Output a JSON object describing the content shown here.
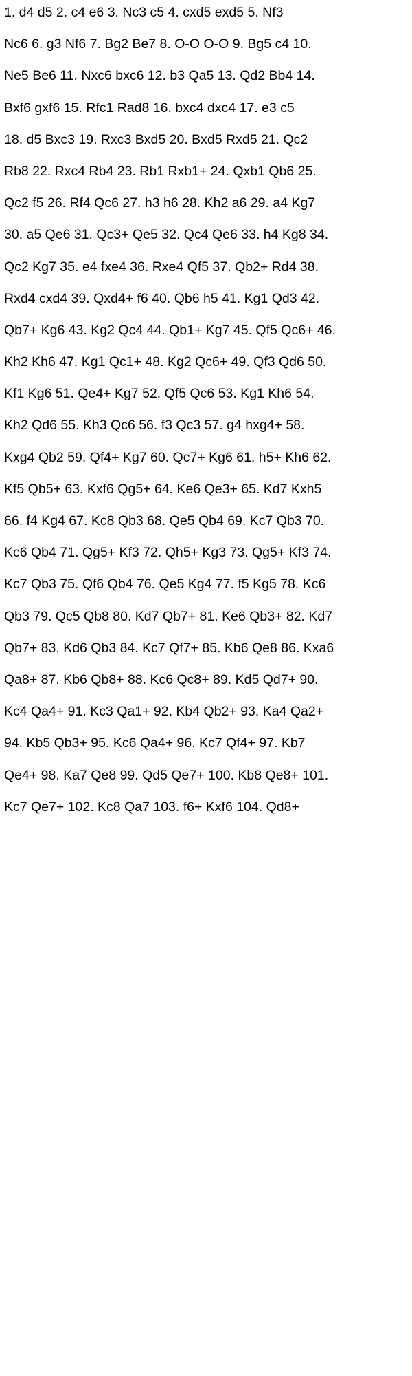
{
  "document": {
    "lines": [
      "1. d4 d5 2. c4 e6 3. Nc3 c5 4. cxd5 exd5 5. Nf3",
      "Nc6 6. g3 Nf6 7. Bg2 Be7 8. O-O O-O 9. Bg5 c4 10.",
      "Ne5 Be6 11. Nxc6 bxc6 12. b3 Qa5 13. Qd2 Bb4 14.",
      "Bxf6 gxf6 15. Rfc1 Rad8 16. bxc4 dxc4 17. e3 c5",
      "18. d5 Bxc3 19. Rxc3 Bxd5 20. Bxd5 Rxd5 21. Qc2",
      "Rb8 22. Rxc4 Rb4 23. Rb1 Rxb1+ 24. Qxb1 Qb6 25.",
      "Qc2 f5 26. Rf4 Qc6 27. h3 h6 28. Kh2 a6 29. a4 Kg7",
      "30. a5 Qe6 31. Qc3+ Qe5 32. Qc4 Qe6 33. h4 Kg8 34.",
      "Qc2 Kg7 35. e4 fxe4 36. Rxe4 Qf5 37. Qb2+ Rd4 38.",
      "Rxd4 cxd4 39. Qxd4+ f6 40. Qb6 h5 41. Kg1 Qd3 42.",
      "Qb7+ Kg6 43. Kg2 Qc4 44. Qb1+ Kg7 45. Qf5 Qc6+ 46.",
      "Kh2 Kh6 47. Kg1 Qc1+ 48. Kg2 Qc6+ 49. Qf3 Qd6 50.",
      "Kf1 Kg6 51. Qe4+ Kg7 52. Qf5 Qc6 53. Kg1 Kh6 54.",
      "Kh2 Qd6 55. Kh3 Qc6 56. f3 Qc3 57. g4 hxg4+ 58.",
      "Kxg4 Qb2 59. Qf4+ Kg7 60. Qc7+ Kg6 61. h5+ Kh6 62.",
      "Kf5 Qb5+ 63. Kxf6 Qg5+ 64. Ke6 Qe3+ 65. Kd7 Kxh5",
      "66. f4 Kg4 67. Kc8 Qb3 68. Qe5 Qb4 69. Kc7 Qb3 70.",
      "Kc6 Qb4 71. Qg5+ Kf3 72. Qh5+ Kg3 73. Qg5+ Kf3 74.",
      "Kc7 Qb3 75. Qf6 Qb4 76. Qe5 Kg4 77. f5 Kg5 78. Kc6",
      "Qb3 79. Qc5 Qb8 80. Kd7 Qb7+ 81. Ke6 Qb3+ 82. Kd7",
      "Qb7+ 83. Kd6 Qb3 84. Kc7 Qf7+ 85. Kb6 Qe8 86. Kxa6",
      "Qa8+ 87. Kb6 Qb8+ 88. Kc6 Qc8+ 89. Kd5 Qd7+ 90.",
      "Kc4 Qa4+ 91. Kc3 Qa1+ 92. Kb4 Qb2+ 93. Ka4 Qa2+",
      "94. Kb5 Qb3+ 95. Kc6 Qa4+ 96. Kc7 Qf4+ 97. Kb7",
      "Qe4+ 98. Ka7 Qe8 99. Qd5 Qe7+ 100. Kb8 Qe8+ 101.",
      "Kc7 Qe7+ 102. Kc8 Qa7 103. f6+ Kxf6 104. Qd8+"
    ]
  }
}
